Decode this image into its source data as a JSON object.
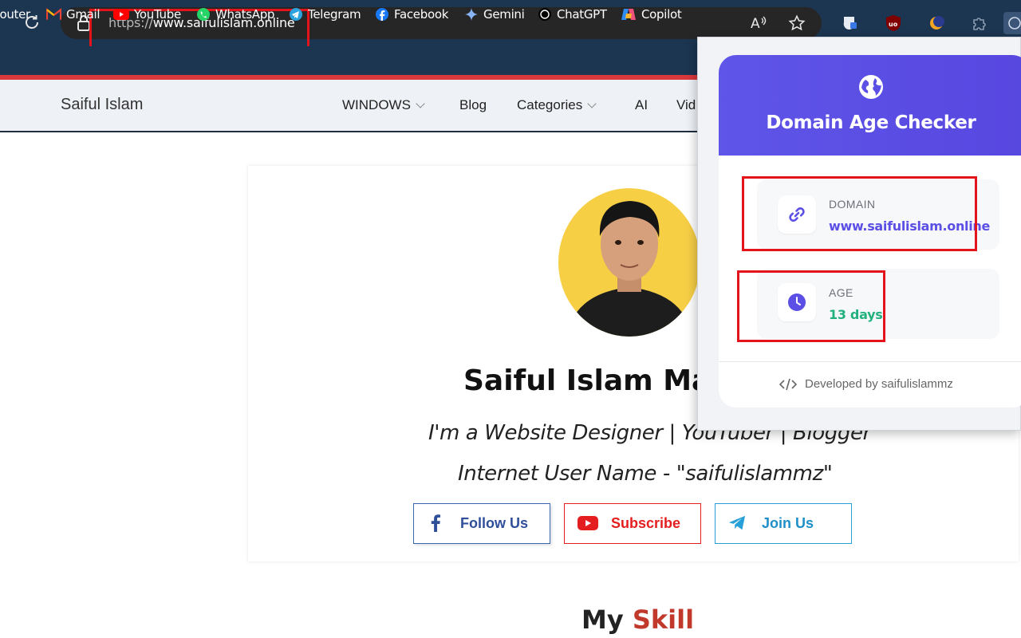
{
  "browser": {
    "url_scheme": "https://",
    "url_host": "www.saifulislam.online",
    "bookmarks": [
      {
        "label": "Router",
        "icon": "router-icon"
      },
      {
        "label": "Gmail",
        "icon": "gmail-icon"
      },
      {
        "label": "YouTube",
        "icon": "youtube-icon"
      },
      {
        "label": "WhatsApp",
        "icon": "whatsapp-icon"
      },
      {
        "label": "Telegram",
        "icon": "telegram-icon"
      },
      {
        "label": "Facebook",
        "icon": "facebook-icon"
      },
      {
        "label": "Gemini",
        "icon": "gemini-icon"
      },
      {
        "label": "ChatGPT",
        "icon": "chatgpt-icon"
      },
      {
        "label": "Copilot",
        "icon": "copilot-icon"
      }
    ]
  },
  "site": {
    "logo": "Saiful Islam",
    "nav": [
      "WINDOWS",
      "Blog",
      "Categories",
      "AI",
      "Vid"
    ]
  },
  "profile": {
    "name": "Saiful Islam Maz",
    "tagline": "I'm a Website Designer | YouTuber | Blogger",
    "username_line": "Internet User Name - \"saifulislammz\"",
    "buttons": {
      "follow": "Follow Us",
      "subscribe": "Subscribe",
      "join": "Join Us"
    }
  },
  "section": {
    "skill_prefix": "My",
    "skill_highlight": "Skill"
  },
  "popup": {
    "title": "Domain Age Checker",
    "domain_label": "DOMAIN",
    "domain_value": "www.saifulislam.online",
    "age_label": "AGE",
    "age_value": "13 days",
    "footer": "Developed by saifulislammz"
  },
  "colors": {
    "chrome": "#1c3550",
    "popup_header": "#5b4fe5",
    "age_value": "#22b07d",
    "domain_value": "#5b4fe5",
    "highlight": "#e3141b",
    "facebook": "#1877f2",
    "youtube": "#e41e1e",
    "telegram": "#27a0d8"
  }
}
